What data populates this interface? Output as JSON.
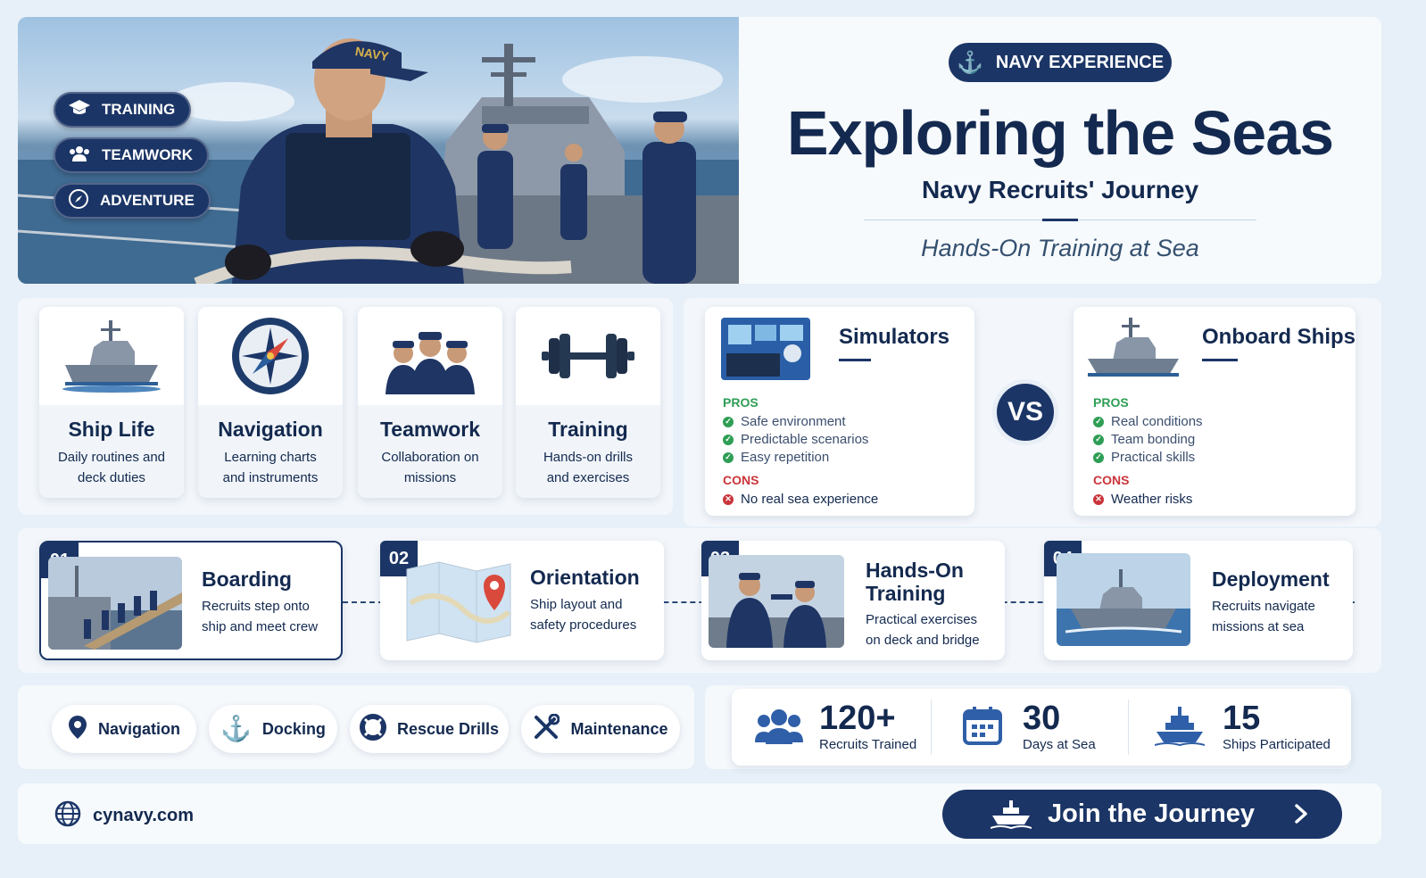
{
  "hero": {
    "chips": [
      {
        "label": "TRAINING",
        "icon": "graduation-cap-icon"
      },
      {
        "label": "TEAMWORK",
        "icon": "users-icon"
      },
      {
        "label": "ADVENTURE",
        "icon": "compass-icon"
      }
    ],
    "cap_text": "NAVY"
  },
  "header": {
    "badge": "NAVY EXPERIENCE",
    "title": "Exploring the Seas",
    "subtitle": "Navy Recruits' Journey",
    "tagline": "Hands-On Training at Sea"
  },
  "topics": [
    {
      "title": "Ship Life",
      "line1": "Daily routines and",
      "line2": "deck duties",
      "icon": "ship-icon"
    },
    {
      "title": "Navigation",
      "line1": "Learning charts",
      "line2": "and instruments",
      "icon": "compass-icon"
    },
    {
      "title": "Teamwork",
      "line1": "Collaboration on",
      "line2": "missions",
      "icon": "sailors-icon"
    },
    {
      "title": "Training",
      "line1": "Hands-on drills",
      "line2": "and exercises",
      "icon": "dumbbell-icon"
    }
  ],
  "compare": {
    "vs": "VS",
    "pros_label": "PROS",
    "cons_label": "CONS",
    "left": {
      "title": "Simulators",
      "pros": [
        "Safe environment",
        "Predictable scenarios",
        "Easy repetition"
      ],
      "cons": [
        "No real sea experience"
      ]
    },
    "right": {
      "title": "Onboard Ships",
      "pros": [
        "Real conditions",
        "Team bonding",
        "Practical skills"
      ],
      "cons": [
        "Weather risks"
      ]
    }
  },
  "steps": [
    {
      "num": "01",
      "title": "Boarding",
      "line1": "Recruits step onto",
      "line2": "ship and meet crew"
    },
    {
      "num": "02",
      "title": "Orientation",
      "line1": "Ship layout and",
      "line2": "safety procedures"
    },
    {
      "num": "03",
      "title1": "Hands-On",
      "title2": "Training",
      "line1": "Practical exercises",
      "line2": "on deck and bridge"
    },
    {
      "num": "04",
      "title": "Deployment",
      "line1": "Recruits navigate",
      "line2": "missions at sea"
    }
  ],
  "skills": [
    {
      "label": "Navigation",
      "icon": "map-pin-icon"
    },
    {
      "label": "Docking",
      "icon": "anchor-icon"
    },
    {
      "label": "Rescue Drills",
      "icon": "lifebuoy-icon"
    },
    {
      "label": "Maintenance",
      "icon": "tools-icon"
    }
  ],
  "stats": [
    {
      "value": "120+",
      "label": "Recruits Trained",
      "icon": "users-icon"
    },
    {
      "value": "30",
      "label": "Days at Sea",
      "icon": "calendar-icon"
    },
    {
      "value": "15",
      "label": "Ships Participated",
      "icon": "ship-icon"
    }
  ],
  "footer": {
    "website": "cynavy.com",
    "cta": "Join the Journey"
  },
  "colors": {
    "navy": "#1b3566",
    "text": "#13294f",
    "pros": "#2e9e55",
    "cons": "#c9343a",
    "background": "#e7f0f8"
  }
}
